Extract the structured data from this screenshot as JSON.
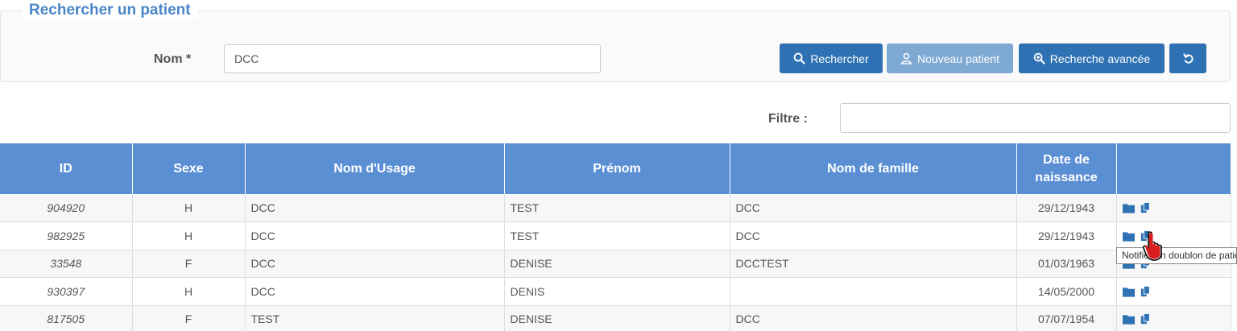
{
  "search": {
    "legend": "Rechercher un patient",
    "nom_label": "Nom *",
    "nom_value": "DCC",
    "buttons": {
      "rechercher": "Rechercher",
      "nouveau_patient": "Nouveau patient",
      "recherche_avancee": "Recherche avancée"
    }
  },
  "filter": {
    "label": "Filtre :",
    "value": ""
  },
  "table": {
    "columns": [
      "ID",
      "Sexe",
      "Nom d'Usage",
      "Prénom",
      "Nom de famille",
      "Date de naissance",
      ""
    ],
    "rows": [
      {
        "id": "904920",
        "sexe": "H",
        "nom_usage": "DCC",
        "prenom": "TEST",
        "nom_famille": "DCC",
        "naissance": "29/12/1943"
      },
      {
        "id": "982925",
        "sexe": "H",
        "nom_usage": "DCC",
        "prenom": "TEST",
        "nom_famille": "DCC",
        "naissance": "29/12/1943"
      },
      {
        "id": "33548",
        "sexe": "F",
        "nom_usage": "DCC",
        "prenom": "DENISE",
        "nom_famille": "DCCTEST",
        "naissance": "01/03/1963"
      },
      {
        "id": "930397",
        "sexe": "H",
        "nom_usage": "DCC",
        "prenom": "DENIS",
        "nom_famille": "",
        "naissance": "14/05/2000"
      },
      {
        "id": "817505",
        "sexe": "F",
        "nom_usage": "TEST",
        "prenom": "DENISE",
        "nom_famille": "DCC",
        "naissance": "07/07/1954"
      }
    ]
  },
  "tooltip": {
    "text": "Notifier un doublon de patient"
  },
  "colors": {
    "header": "#5b8fd4",
    "primary_button": "#2f72b4",
    "legend": "#4a86c8"
  },
  "icons": [
    "search-icon",
    "user-icon",
    "zoom-in-icon",
    "undo-icon",
    "folder-icon",
    "copy-icon",
    "hand-cursor-icon"
  ]
}
